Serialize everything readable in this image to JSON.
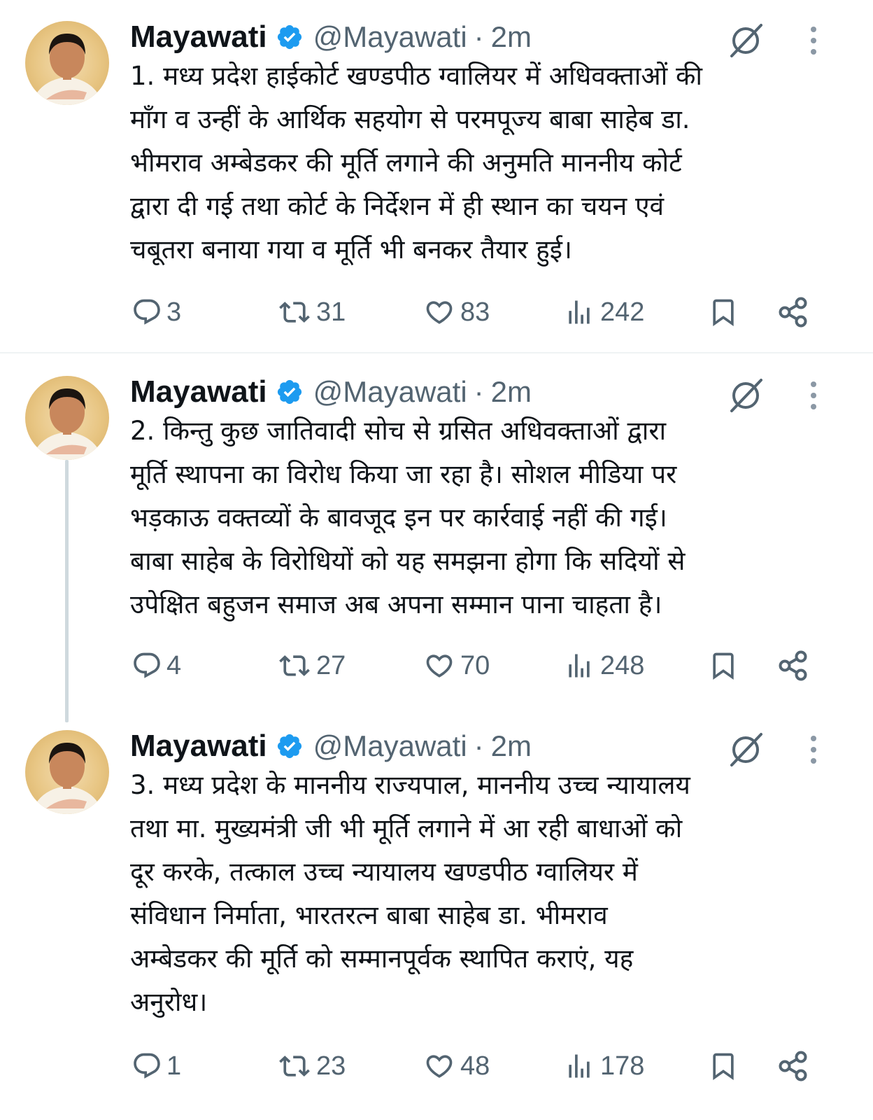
{
  "tweets": [
    {
      "name": "Mayawati",
      "handle": "@Mayawati",
      "separator": "·",
      "time": "2m",
      "lines": [
        "1. मध्य प्रदेश हाईकोर्ट खण्डपीठ ग्वालियर में अधिवक्ताओं की",
        "माँग व उन्हीं के आर्थिक सहयोग से परमपूज्य बाबा साहेब डा.",
        "भीमराव अम्बेडकर की मूर्ति लगाने की अनुमति माननीय कोर्ट",
        "द्वारा दी गई तथा कोर्ट के निर्देशन में ही स्थान का चयन एवं",
        "चबूतरा बनाया गया व मूर्ति भी बनकर तैयार हुई।"
      ],
      "replies": "3",
      "reposts": "31",
      "likes": "83",
      "views": "242"
    },
    {
      "name": "Mayawati",
      "handle": "@Mayawati",
      "separator": "·",
      "time": "2m",
      "lines": [
        "2. किन्तु कुछ जातिवादी सोच से ग्रसित अधिवक्ताओं द्वारा",
        "मूर्ति स्थापना का विरोध किया जा रहा है। सोशल मीडिया पर",
        "भड़काऊ वक्तव्यों के बावजूद इन पर कार्रवाई नहीं की गई।",
        "बाबा साहेब के विरोधियों को यह समझना होगा कि सदियों से",
        "उपेक्षित बहुजन समाज अब अपना सम्मान पाना चाहता है।"
      ],
      "replies": "4",
      "reposts": "27",
      "likes": "70",
      "views": "248"
    },
    {
      "name": "Mayawati",
      "handle": "@Mayawati",
      "separator": "·",
      "time": "2m",
      "lines": [
        "3. मध्य प्रदेश के माननीय राज्यपाल, माननीय उच्च न्यायालय",
        "तथा मा. मुख्यमंत्री जी भी मूर्ति लगाने में आ रही बाधाओं को",
        "दूर करके, तत्काल उच्च न्यायालय खण्डपीठ ग्वालियर में",
        "संविधान निर्माता, भारतरत्न बाबा साहेब डा. भीमराव",
        "अम्बेडकर की मूर्ति को सम्मानपूर्वक स्थापित कराएं, यह",
        "अनुरोध।"
      ],
      "replies": "1",
      "reposts": "23",
      "likes": "48",
      "views": "178"
    }
  ],
  "icons": {
    "verified": "verified-badge-icon",
    "grok": "grok-icon",
    "more": "more-options-icon",
    "reply": "reply-icon",
    "repost": "repost-icon",
    "like": "like-icon",
    "views": "views-icon",
    "bookmark": "bookmark-icon",
    "share": "share-icon"
  },
  "colors": {
    "verified": "#1d9bf0",
    "text": "#0f1419",
    "muted": "#536471",
    "thread_line": "#cfd9de"
  }
}
